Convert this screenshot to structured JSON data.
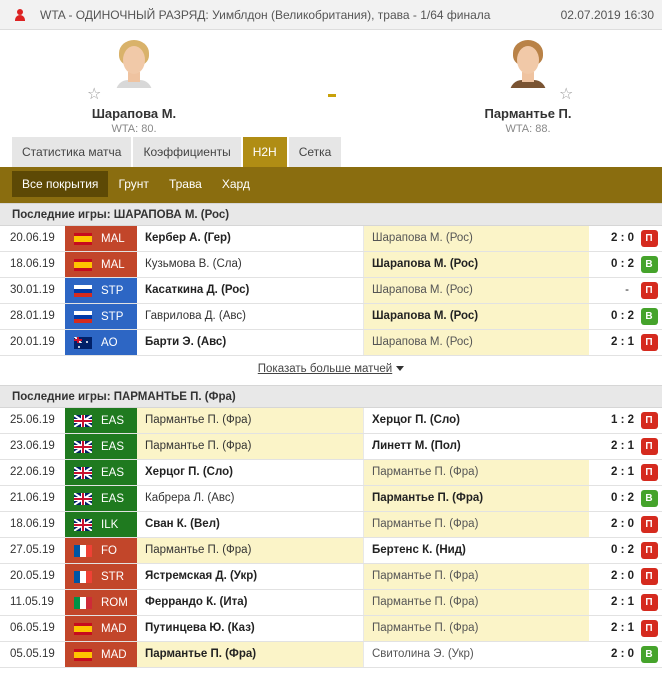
{
  "topbar": {
    "title": "WTA - ОДИНОЧНЫЙ РАЗРЯД: Уимблдон (Великобритания), трава - 1/64 финала",
    "date": "02.07.2019 16:30"
  },
  "players": [
    {
      "name": "Шарапова М.",
      "rank": "WTA: 80."
    },
    {
      "name": "Пармантье П.",
      "rank": "WTA: 88."
    }
  ],
  "score_separator": "-",
  "tabs": [
    "Статистика матча",
    "Коэффициенты",
    "H2H",
    "Сетка"
  ],
  "active_tab": "H2H",
  "surface_tabs": [
    "Все покрытия",
    "Грунт",
    "Трава",
    "Хард"
  ],
  "colors": {
    "accent": "#8a6d0f",
    "tab_active": "#b08d14",
    "win": "#45a32b",
    "lose": "#d52a1e",
    "highlight": "#fbf4c8"
  },
  "section1": {
    "title": "Последние игры: ШАРАПОВА М. (Рос)",
    "rows": [
      {
        "date": "20.06.19",
        "tour": "MAL",
        "flag": "es",
        "p1": "Кербер А. (Гер)",
        "p2": "Шарапова М. (Рос)",
        "score": "2 : 0",
        "result": "П"
      },
      {
        "date": "18.06.19",
        "tour": "MAL",
        "flag": "es",
        "p1": "Кузьмова В. (Сла)",
        "p2": "Шарапова М. (Рос)",
        "score": "0 : 2",
        "result": "В"
      },
      {
        "date": "30.01.19",
        "tour": "STP",
        "flag": "ru",
        "p1": "Касаткина Д. (Рос)",
        "p2": "Шарапова М. (Рос)",
        "score": "-",
        "result": "П"
      },
      {
        "date": "28.01.19",
        "tour": "STP",
        "flag": "ru",
        "p1": "Гаврилова Д. (Авс)",
        "p2": "Шарапова М. (Рос)",
        "score": "0 : 2",
        "result": "В"
      },
      {
        "date": "20.01.19",
        "tour": "AO",
        "flag": "au",
        "p1": "Барти Э. (Авс)",
        "p2": "Шарапова М. (Рос)",
        "score": "2 : 1",
        "result": "П"
      }
    ],
    "more": "Показать больше матчей"
  },
  "section2": {
    "title": "Последние игры: ПАРМАНТЬЕ П. (Фра)",
    "rows": [
      {
        "date": "25.06.19",
        "tour": "EAS",
        "flag": "gb",
        "p1": "Пармантье П. (Фра)",
        "p2": "Херцог П. (Сло)",
        "score": "1 : 2",
        "result": "П"
      },
      {
        "date": "23.06.19",
        "tour": "EAS",
        "flag": "gb",
        "p1": "Пармантье П. (Фра)",
        "p2": "Линетт М. (Пол)",
        "score": "2 : 1",
        "result": "П"
      },
      {
        "date": "22.06.19",
        "tour": "EAS",
        "flag": "gb",
        "p1": "Херцог П. (Сло)",
        "p2": "Пармантье П. (Фра)",
        "score": "2 : 1",
        "result": "П"
      },
      {
        "date": "21.06.19",
        "tour": "EAS",
        "flag": "gb",
        "p1": "Кабрера Л. (Авс)",
        "p2": "Пармантье П. (Фра)",
        "score": "0 : 2",
        "result": "В"
      },
      {
        "date": "18.06.19",
        "tour": "ILK",
        "flag": "gb",
        "p1": "Сван К. (Вел)",
        "p2": "Пармантье П. (Фра)",
        "score": "2 : 0",
        "result": "П"
      },
      {
        "date": "27.05.19",
        "tour": "FO",
        "flag": "fr",
        "p1": "Пармантье П. (Фра)",
        "p2": "Бертенс К. (Нид)",
        "score": "0 : 2",
        "result": "П"
      },
      {
        "date": "20.05.19",
        "tour": "STR",
        "flag": "fr",
        "p1": "Ястремская Д. (Укр)",
        "p2": "Пармантье П. (Фра)",
        "score": "2 : 0",
        "result": "П"
      },
      {
        "date": "11.05.19",
        "tour": "ROM",
        "flag": "it",
        "p1": "Феррандо К. (Ита)",
        "p2": "Пармантье П. (Фра)",
        "score": "2 : 1",
        "result": "П"
      },
      {
        "date": "06.05.19",
        "tour": "MAD",
        "flag": "es",
        "p1": "Путинцева Ю. (Каз)",
        "p2": "Пармантье П. (Фра)",
        "score": "2 : 1",
        "result": "П"
      },
      {
        "date": "05.05.19",
        "tour": "MAD",
        "flag": "es",
        "p1": "Пармантье П. (Фра)",
        "p2": "Свитолина Э. (Укр)",
        "score": "2 : 0",
        "result": "В"
      }
    ]
  }
}
